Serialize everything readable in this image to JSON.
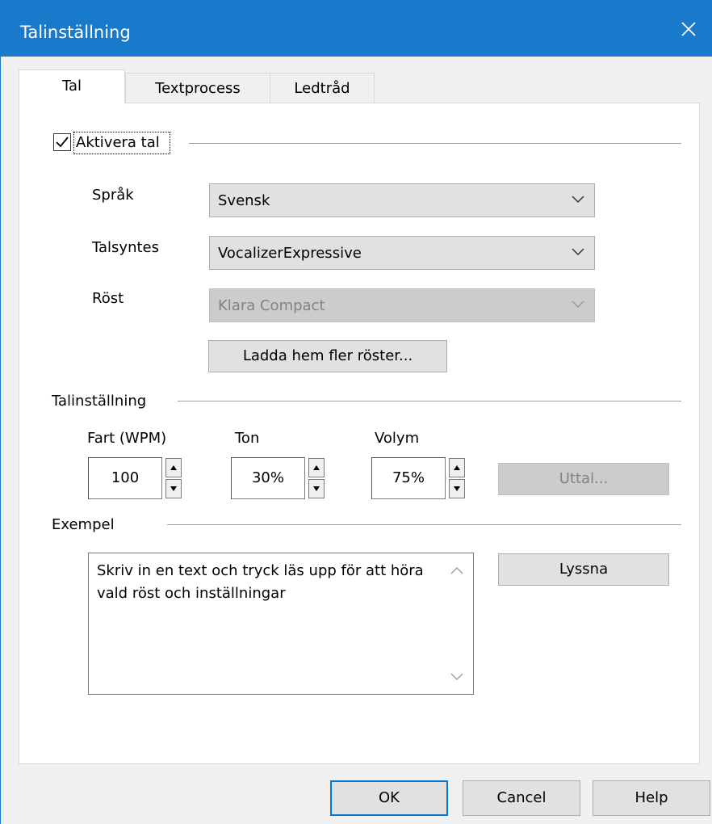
{
  "window": {
    "title": "Talinställning"
  },
  "tabs": [
    {
      "label": "Tal",
      "active": true
    },
    {
      "label": "Textprocess",
      "active": false
    },
    {
      "label": "Ledtråd",
      "active": false
    }
  ],
  "speech": {
    "enable_label": "Aktivera tal",
    "enable_checked": true,
    "language_label": "Språk",
    "language_value": "Svensk",
    "synth_label": "Talsyntes",
    "synth_value": "VocalizerExpressive",
    "voice_label": "Röst",
    "voice_value": "Klara Compact",
    "download_button": "Ladda hem fler röster..."
  },
  "settings": {
    "section_label": "Talinställning",
    "rate_label": "Fart (WPM)",
    "rate_value": "100",
    "pitch_label": "Ton",
    "pitch_value": "30%",
    "volume_label": "Volym",
    "volume_value": "75%",
    "pronounce_button": "Uttal..."
  },
  "example": {
    "section_label": "Exempel",
    "text": "Skriv in en text och tryck läs upp för att höra vald röst och inställningar",
    "listen_button": "Lyssna"
  },
  "footer": {
    "ok": "OK",
    "cancel": "Cancel",
    "help": "Help"
  },
  "colors": {
    "titlebar": "#1979ca",
    "focus_border": "#0078d7"
  }
}
